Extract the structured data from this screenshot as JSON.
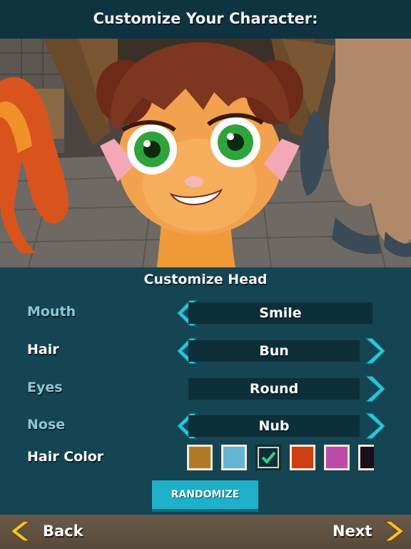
{
  "header": {
    "title": "Customize Your Character:"
  },
  "scene": {
    "description_icon": "character-3d-preview"
  },
  "panel": {
    "section_title": "Customize Head",
    "options": [
      {
        "label": "Mouth",
        "value": "Smile",
        "left_arrow": true,
        "right_arrow": false,
        "highlighted": false
      },
      {
        "label": "Hair",
        "value": "Bun",
        "left_arrow": true,
        "right_arrow": true,
        "highlighted": true
      },
      {
        "label": "Eyes",
        "value": "Round",
        "left_arrow": false,
        "right_arrow": true,
        "highlighted": false
      },
      {
        "label": "Nose",
        "value": "Nub",
        "left_arrow": true,
        "right_arrow": true,
        "highlighted": false
      }
    ],
    "hair_color": {
      "label": "Hair Color",
      "swatches": [
        "#b2782a",
        "#62b6d4",
        "#0f2e36",
        "#cf3e10",
        "#bd4aa8",
        "#1a0c1a"
      ],
      "selected_index": 2
    },
    "randomize_label": "RANDOMIZE"
  },
  "footer": {
    "back_label": "Back",
    "next_label": "Next"
  },
  "colors": {
    "accent": "#1eb0c8",
    "arrow": "#2cc4dc",
    "nav_arrow": "#f0c23a",
    "panel": "#154452"
  }
}
